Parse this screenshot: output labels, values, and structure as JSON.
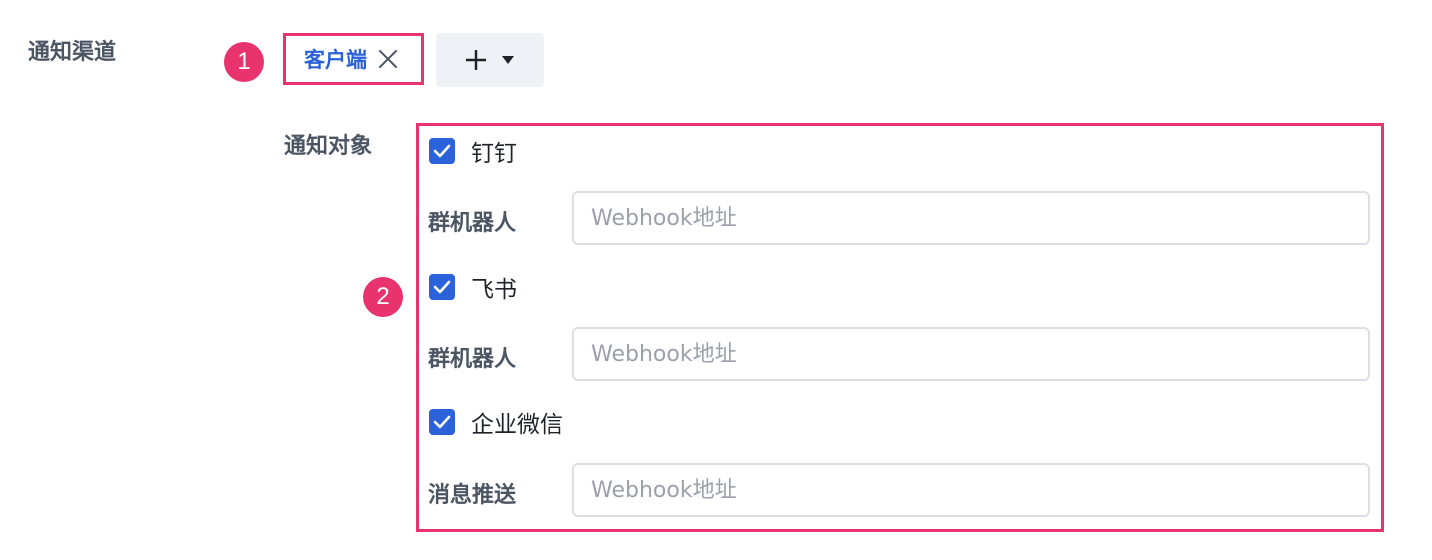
{
  "notify_channel": {
    "label": "通知渠道",
    "selected_tag": "客户端"
  },
  "badges": [
    "1",
    "2"
  ],
  "notify_targets": {
    "label": "通知对象",
    "groups": [
      {
        "name": "钉钉",
        "checked": true,
        "field_label": "群机器人",
        "placeholder": "Webhook地址",
        "value": ""
      },
      {
        "name": "飞书",
        "checked": true,
        "field_label": "群机器人",
        "placeholder": "Webhook地址",
        "value": ""
      },
      {
        "name": "企业微信",
        "checked": true,
        "field_label": "消息推送",
        "placeholder": "Webhook地址",
        "value": ""
      }
    ]
  },
  "colors": {
    "accent": "#2b62d9",
    "highlight": "#e8336f",
    "label": "#4b5563"
  }
}
